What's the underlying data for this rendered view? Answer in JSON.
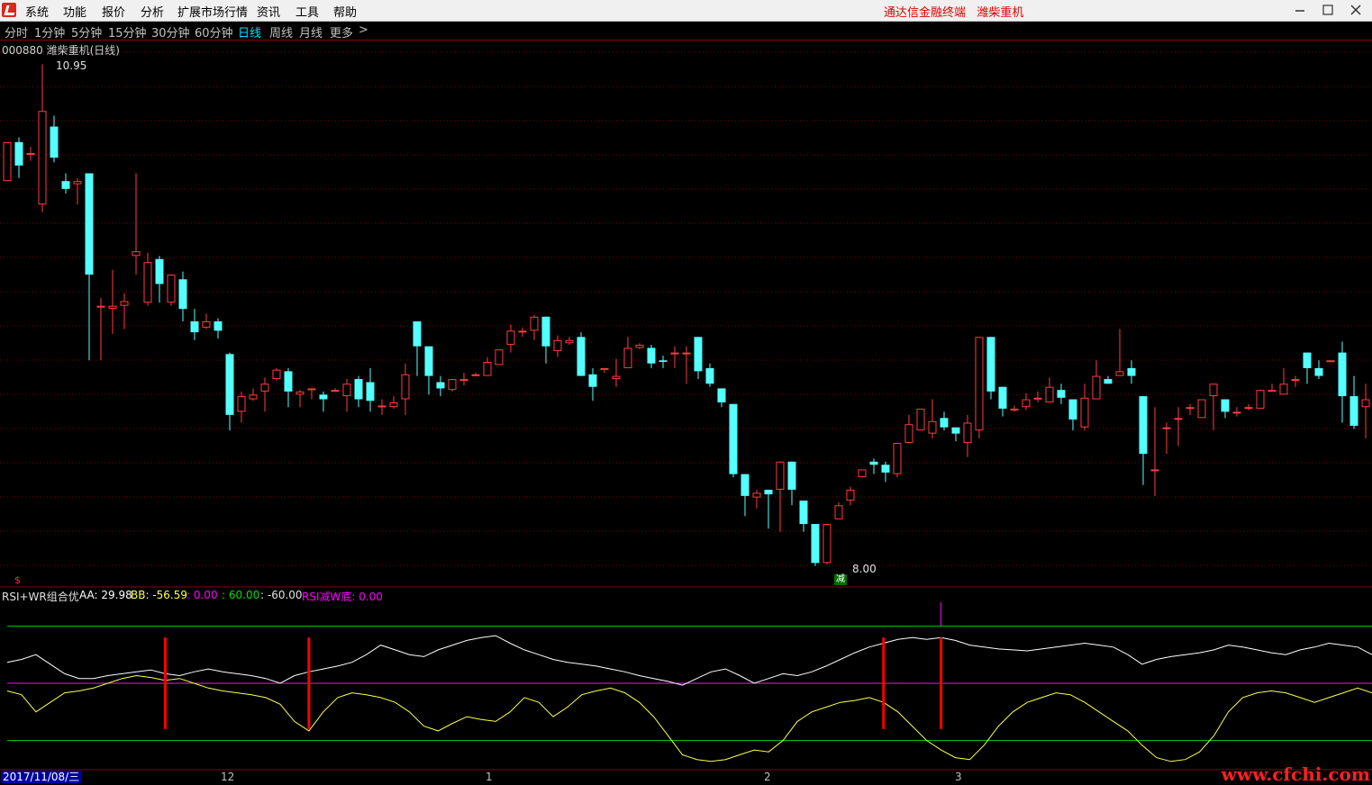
{
  "menu": {
    "items": [
      "系统",
      "功能",
      "报价",
      "分析",
      "扩展市场行情",
      "资讯",
      "工具",
      "帮助"
    ],
    "brand": "通达信金融终端",
    "stock_name": "潍柴重机"
  },
  "periods": {
    "items": [
      "分时",
      "1分钟",
      "5分钟",
      "15分钟",
      "30分钟",
      "60分钟",
      "日线",
      "周线",
      "月线",
      "更多"
    ],
    "active": "日线",
    "more_arrow": ">"
  },
  "ticker": {
    "text": "000880 潍柴重机(日线)"
  },
  "price": {
    "high_label": "10.95",
    "low_label": "8.00"
  },
  "signal": {
    "label": "减",
    "marker": "$"
  },
  "indicator": {
    "name": "RSI+WR组合优",
    "aa": "AA: 29.98",
    "bb": "BB: -56.59",
    "v1": ": 0.00",
    "v2": ": 60.00",
    "v3": ": -60.00",
    "rsi": "RSI减W底: 0.00"
  },
  "time_axis": {
    "date": "2017/11/08/三",
    "labels": [
      "12",
      "1",
      "2",
      "3"
    ]
  },
  "watermark": "www.cfchi.com",
  "colors": {
    "up": "#ff3c3c",
    "down": "#54ffff",
    "grid": "#80000b",
    "white_line": "#ffffff",
    "yellow_line": "#ffff4c",
    "magenta": "#ff00ff",
    "green_line": "#00c000",
    "signal": "#ff0000"
  },
  "chart_data": {
    "type": "candlestick",
    "ylim": [
      7.7,
      11.05
    ],
    "candles": [
      [
        10.2,
        10.45,
        10.2,
        10.45
      ],
      [
        10.45,
        10.3,
        10.22,
        10.48
      ],
      [
        10.38,
        10.38,
        10.33,
        10.42
      ],
      [
        10.05,
        10.65,
        10.0,
        10.95
      ],
      [
        10.55,
        10.35,
        10.32,
        10.62
      ],
      [
        10.2,
        10.15,
        10.12,
        10.25
      ],
      [
        10.18,
        10.2,
        10.05,
        10.22
      ],
      [
        10.25,
        9.6,
        9.05,
        10.25
      ],
      [
        9.4,
        9.4,
        9.05,
        9.45
      ],
      [
        9.38,
        9.4,
        9.22,
        9.63
      ],
      [
        9.4,
        9.43,
        9.25,
        9.48
      ],
      [
        9.72,
        9.75,
        9.6,
        10.25
      ],
      [
        9.42,
        9.68,
        9.4,
        9.74
      ],
      [
        9.7,
        9.54,
        9.42,
        9.72
      ],
      [
        9.42,
        9.6,
        9.4,
        9.6
      ],
      [
        9.57,
        9.38,
        9.3,
        9.62
      ],
      [
        9.3,
        9.23,
        9.18,
        9.38
      ],
      [
        9.26,
        9.3,
        9.25,
        9.35
      ],
      [
        9.3,
        9.24,
        9.19,
        9.32
      ],
      [
        9.09,
        8.7,
        8.6,
        9.1
      ],
      [
        8.72,
        8.82,
        8.65,
        8.85
      ],
      [
        8.8,
        8.83,
        8.79,
        8.87
      ],
      [
        8.85,
        8.9,
        8.72,
        8.94
      ],
      [
        8.93,
        8.99,
        8.92,
        9.0
      ],
      [
        8.98,
        8.85,
        8.75,
        9.0
      ],
      [
        8.83,
        8.85,
        8.75,
        8.86
      ],
      [
        8.87,
        8.87,
        8.8,
        8.87
      ],
      [
        8.83,
        8.8,
        8.72,
        8.85
      ],
      [
        8.86,
        8.86,
        8.85,
        8.87
      ],
      [
        8.82,
        8.9,
        8.72,
        8.93
      ],
      [
        8.93,
        8.8,
        8.75,
        8.95
      ],
      [
        8.91,
        8.79,
        8.72,
        9.0
      ],
      [
        8.76,
        8.76,
        8.7,
        8.8
      ],
      [
        8.75,
        8.78,
        8.74,
        8.82
      ],
      [
        8.8,
        8.96,
        8.7,
        9.03
      ],
      [
        9.3,
        9.14,
        8.95,
        9.3
      ],
      [
        9.14,
        8.95,
        8.83,
        9.14
      ],
      [
        8.91,
        8.87,
        8.82,
        8.95
      ],
      [
        8.86,
        8.93,
        8.85,
        8.93
      ],
      [
        8.92,
        8.93,
        8.89,
        8.97
      ],
      [
        8.95,
        8.96,
        8.95,
        8.97
      ],
      [
        8.95,
        9.04,
        8.98,
        9.07
      ],
      [
        9.02,
        9.12,
        9.05,
        9.12
      ],
      [
        9.15,
        9.24,
        9.1,
        9.28
      ],
      [
        9.24,
        9.24,
        9.2,
        9.26
      ],
      [
        9.24,
        9.33,
        9.18,
        9.34
      ],
      [
        9.33,
        9.14,
        9.03,
        9.33
      ],
      [
        9.11,
        9.18,
        9.07,
        9.21
      ],
      [
        9.16,
        9.18,
        9.15,
        9.2
      ],
      [
        9.2,
        8.95,
        8.95,
        9.23
      ],
      [
        8.96,
        8.88,
        8.79,
        9.0
      ],
      [
        9.0,
        9.0,
        8.97,
        9.0
      ],
      [
        8.93,
        8.95,
        8.88,
        9.06
      ],
      [
        9.0,
        9.13,
        9.0,
        9.2
      ],
      [
        9.13,
        9.15,
        9.12,
        9.16
      ],
      [
        9.13,
        9.03,
        9.0,
        9.15
      ],
      [
        9.05,
        9.04,
        9.0,
        9.08
      ],
      [
        9.09,
        9.1,
        9.0,
        9.14
      ],
      [
        9.1,
        9.1,
        8.9,
        9.14
      ],
      [
        9.2,
        8.98,
        8.93,
        9.2
      ],
      [
        9.0,
        8.9,
        8.88,
        9.03
      ],
      [
        8.87,
        8.78,
        8.75,
        8.87
      ],
      [
        8.77,
        8.32,
        8.3,
        8.77
      ],
      [
        8.32,
        8.18,
        8.05,
        8.32
      ],
      [
        8.17,
        8.2,
        8.1,
        8.22
      ],
      [
        8.22,
        8.19,
        7.97,
        8.22
      ],
      [
        8.22,
        8.4,
        7.95,
        8.4
      ],
      [
        8.4,
        8.22,
        8.12,
        8.4
      ],
      [
        8.15,
        8.0,
        7.95,
        8.15
      ],
      [
        8.0,
        7.75,
        7.73,
        8.0
      ],
      [
        7.75,
        8.0,
        7.74,
        8.0
      ],
      [
        8.03,
        8.12,
        8.1,
        8.14
      ],
      [
        8.15,
        8.22,
        8.12,
        8.24
      ],
      [
        8.3,
        8.35,
        8.3,
        8.35
      ],
      [
        8.4,
        8.38,
        8.32,
        8.42
      ],
      [
        8.38,
        8.33,
        8.27,
        8.4
      ],
      [
        8.32,
        8.52,
        8.3,
        8.52
      ],
      [
        8.52,
        8.64,
        8.55,
        8.7
      ],
      [
        8.6,
        8.74,
        8.6,
        8.74
      ],
      [
        8.58,
        8.66,
        8.55,
        8.8
      ],
      [
        8.68,
        8.62,
        8.6,
        8.72
      ],
      [
        8.62,
        8.58,
        8.53,
        8.62
      ],
      [
        8.52,
        8.65,
        8.43,
        8.7
      ],
      [
        8.6,
        9.2,
        8.55,
        9.2
      ],
      [
        9.2,
        8.85,
        8.8,
        9.2
      ],
      [
        8.88,
        8.74,
        8.69,
        8.88
      ],
      [
        8.74,
        8.74,
        8.72,
        8.76
      ],
      [
        8.75,
        8.8,
        8.73,
        8.84
      ],
      [
        8.8,
        8.81,
        8.78,
        8.85
      ],
      [
        8.78,
        8.88,
        8.78,
        8.94
      ],
      [
        8.86,
        8.81,
        8.77,
        8.9
      ],
      [
        8.8,
        8.67,
        8.6,
        8.8
      ],
      [
        8.62,
        8.81,
        8.6,
        8.9
      ],
      [
        8.8,
        8.95,
        8.8,
        9.05
      ],
      [
        8.93,
        8.9,
        8.9,
        8.95
      ],
      [
        8.95,
        8.98,
        8.95,
        9.25
      ],
      [
        9.0,
        8.95,
        8.9,
        9.05
      ],
      [
        8.82,
        8.45,
        8.25,
        8.82
      ],
      [
        8.35,
        8.35,
        8.18,
        8.75
      ],
      [
        8.62,
        8.62,
        8.45,
        8.65
      ],
      [
        8.68,
        8.68,
        8.5,
        8.75
      ],
      [
        8.75,
        8.75,
        8.7,
        8.77
      ],
      [
        8.68,
        8.8,
        8.68,
        8.8
      ],
      [
        8.82,
        8.9,
        8.6,
        8.9
      ],
      [
        8.8,
        8.72,
        8.68,
        8.8
      ],
      [
        8.71,
        8.72,
        8.69,
        8.75
      ],
      [
        8.74,
        8.75,
        8.73,
        8.77
      ],
      [
        8.74,
        8.86,
        8.75,
        8.86
      ],
      [
        8.86,
        8.86,
        8.85,
        8.9
      ],
      [
        8.83,
        8.9,
        8.85,
        9.0
      ],
      [
        8.92,
        8.93,
        8.88,
        8.95
      ],
      [
        9.1,
        9.0,
        8.9,
        9.1
      ],
      [
        9.0,
        8.95,
        8.93,
        9.05
      ],
      [
        9.05,
        9.05,
        9.05,
        9.05
      ],
      [
        9.1,
        8.82,
        8.65,
        9.17
      ],
      [
        8.82,
        8.63,
        8.61,
        8.95
      ],
      [
        8.75,
        8.8,
        8.55,
        8.9
      ]
    ]
  },
  "indicator_data": {
    "type": "line",
    "ylim": [
      -85,
      85
    ],
    "white": [
      22,
      25,
      30,
      20,
      10,
      5,
      5,
      8,
      10,
      12,
      14,
      10,
      8,
      12,
      15,
      12,
      10,
      8,
      5,
      0,
      8,
      12,
      15,
      18,
      22,
      30,
      40,
      35,
      30,
      28,
      35,
      40,
      45,
      48,
      50,
      42,
      35,
      30,
      25,
      22,
      20,
      18,
      15,
      12,
      8,
      5,
      2,
      -2,
      5,
      12,
      15,
      8,
      0,
      5,
      10,
      8,
      12,
      18,
      25,
      32,
      38,
      42,
      46,
      48,
      46,
      48,
      45,
      40,
      38,
      36,
      35,
      34,
      36,
      38,
      40,
      42,
      40,
      38,
      30,
      20,
      25,
      28,
      30,
      32,
      35,
      40,
      38,
      35,
      32,
      30,
      35,
      38,
      42,
      40,
      38,
      30
    ],
    "yellow": [
      -8,
      -12,
      -30,
      -20,
      -10,
      -8,
      -5,
      0,
      5,
      8,
      6,
      3,
      5,
      0,
      -5,
      -8,
      -10,
      -12,
      -15,
      -22,
      -40,
      -50,
      -30,
      -15,
      -10,
      -12,
      -15,
      -20,
      -30,
      -45,
      -50,
      -42,
      -35,
      -38,
      -40,
      -30,
      -15,
      -20,
      -35,
      -25,
      -12,
      -8,
      -5,
      -10,
      -20,
      -35,
      -55,
      -75,
      -80,
      -82,
      -80,
      -75,
      -70,
      -72,
      -60,
      -40,
      -30,
      -25,
      -20,
      -18,
      -15,
      -20,
      -30,
      -45,
      -60,
      -70,
      -78,
      -80,
      -65,
      -45,
      -30,
      -20,
      -15,
      -10,
      -12,
      -20,
      -30,
      -40,
      -50,
      -65,
      -78,
      -82,
      -80,
      -72,
      -55,
      -30,
      -15,
      -10,
      -8,
      -10,
      -15,
      -20,
      -15,
      -10,
      -5,
      -10
    ],
    "signals": [
      11,
      21,
      61,
      65
    ]
  }
}
